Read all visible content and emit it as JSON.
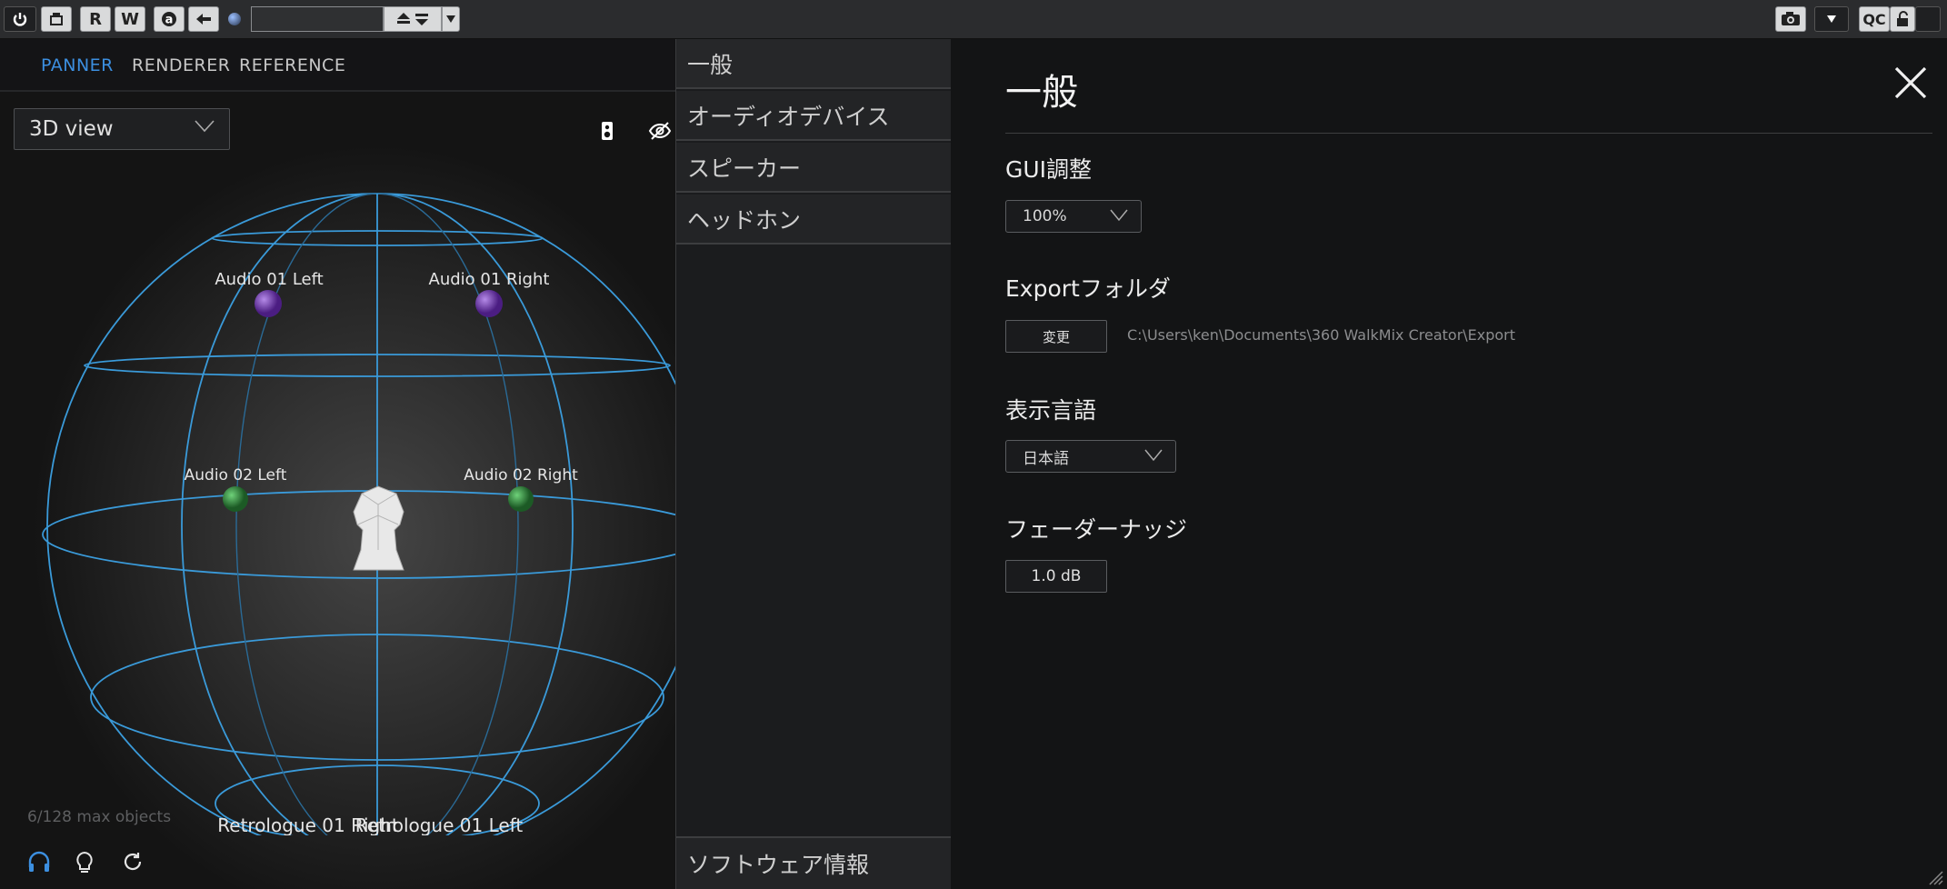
{
  "toolbar": {
    "read_label": "R",
    "write_label": "W",
    "auto_label": "a",
    "qc_label": "QC",
    "preset_field": ""
  },
  "panner": {
    "tabs": [
      {
        "label": "PANNER",
        "active": true
      },
      {
        "label": "RENDERER",
        "active": false
      },
      {
        "label": "REFERENCE",
        "active": false
      }
    ],
    "view_select": "3D view",
    "objects": [
      {
        "label": "Audio 01 Left",
        "color": "#6a2aa8"
      },
      {
        "label": "Audio 01 Right",
        "color": "#6a2aa8"
      },
      {
        "label": "Audio 02 Left",
        "color": "#2f8a3a"
      },
      {
        "label": "Audio 02 Right",
        "color": "#2f8a3a"
      },
      {
        "label": "Retrologue 01 Right",
        "color": "#b7c23a"
      },
      {
        "label": "Retrologue 01 Left",
        "color": "#b7c23a"
      }
    ],
    "max_objects": "6/128 max objects",
    "accent_color": "#3c8fe0",
    "grid_color": "#3a9ad9",
    "icons": [
      "speaker-icon",
      "visibility-off-icon",
      "headphones-icon",
      "lightbulb-icon",
      "refresh-icon"
    ]
  },
  "categories": {
    "items": [
      {
        "label": "一般",
        "active": true
      },
      {
        "label": "オーディオデバイス",
        "active": false
      },
      {
        "label": "スピーカー",
        "active": false
      },
      {
        "label": "ヘッドホン",
        "active": false
      }
    ],
    "about": "ソフトウェア情報"
  },
  "settings": {
    "title": "一般",
    "gui_scale": {
      "label": "GUI調整",
      "value": "100%"
    },
    "export_folder": {
      "label": "Exportフォルダ",
      "button": "変更",
      "path": "C:\\Users\\ken\\Documents\\360 WalkMix Creator\\Export"
    },
    "language": {
      "label": "表示言語",
      "value": "日本語"
    },
    "fader_nudge": {
      "label": "フェーダーナッジ",
      "value": "1.0 dB"
    }
  }
}
